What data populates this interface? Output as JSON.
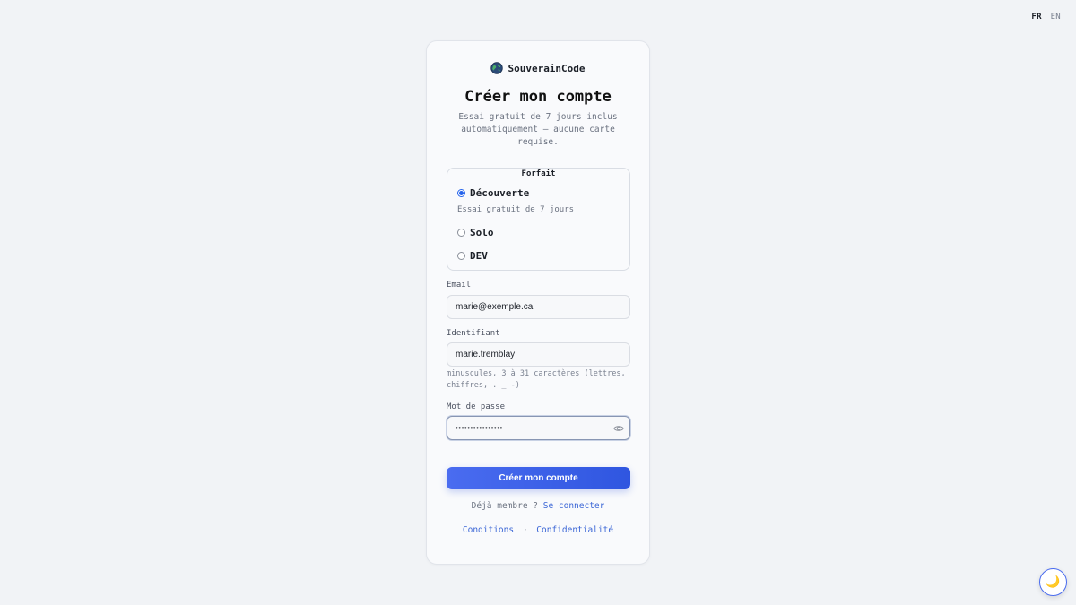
{
  "language": {
    "active": "FR",
    "other": "EN"
  },
  "brand": {
    "name": "SouverainCode",
    "logo_icon": "globe-icon"
  },
  "title": "Créer mon compte",
  "subtitle": "Essai gratuit de 7 jours inclus automatiquement — aucune carte requise.",
  "plan": {
    "legend": "Forfait",
    "options": [
      {
        "label": "Découverte",
        "selected": true,
        "description": "Essai gratuit de 7 jours"
      },
      {
        "label": "Solo",
        "selected": false
      },
      {
        "label": "DEV",
        "selected": false
      }
    ]
  },
  "email": {
    "label": "Email",
    "value": "marie@exemple.ca"
  },
  "username": {
    "label": "Identifiant",
    "value": "marie.tremblay",
    "hint": "minuscules, 3 à 31 caractères (lettres, chiffres, . _ -)"
  },
  "password": {
    "label": "Mot de passe",
    "value": "••••••••••••••••",
    "toggle_icon": "eye-icon"
  },
  "submit_label": "Créer mon compte",
  "login_prompt": {
    "text": "Déjà membre ?",
    "link": "Se connecter"
  },
  "footer": {
    "terms": "Conditions",
    "separator": "·",
    "privacy": "Confidentialité"
  },
  "theme_toggle": {
    "icon": "moon-icon",
    "glyph": "🌙"
  }
}
